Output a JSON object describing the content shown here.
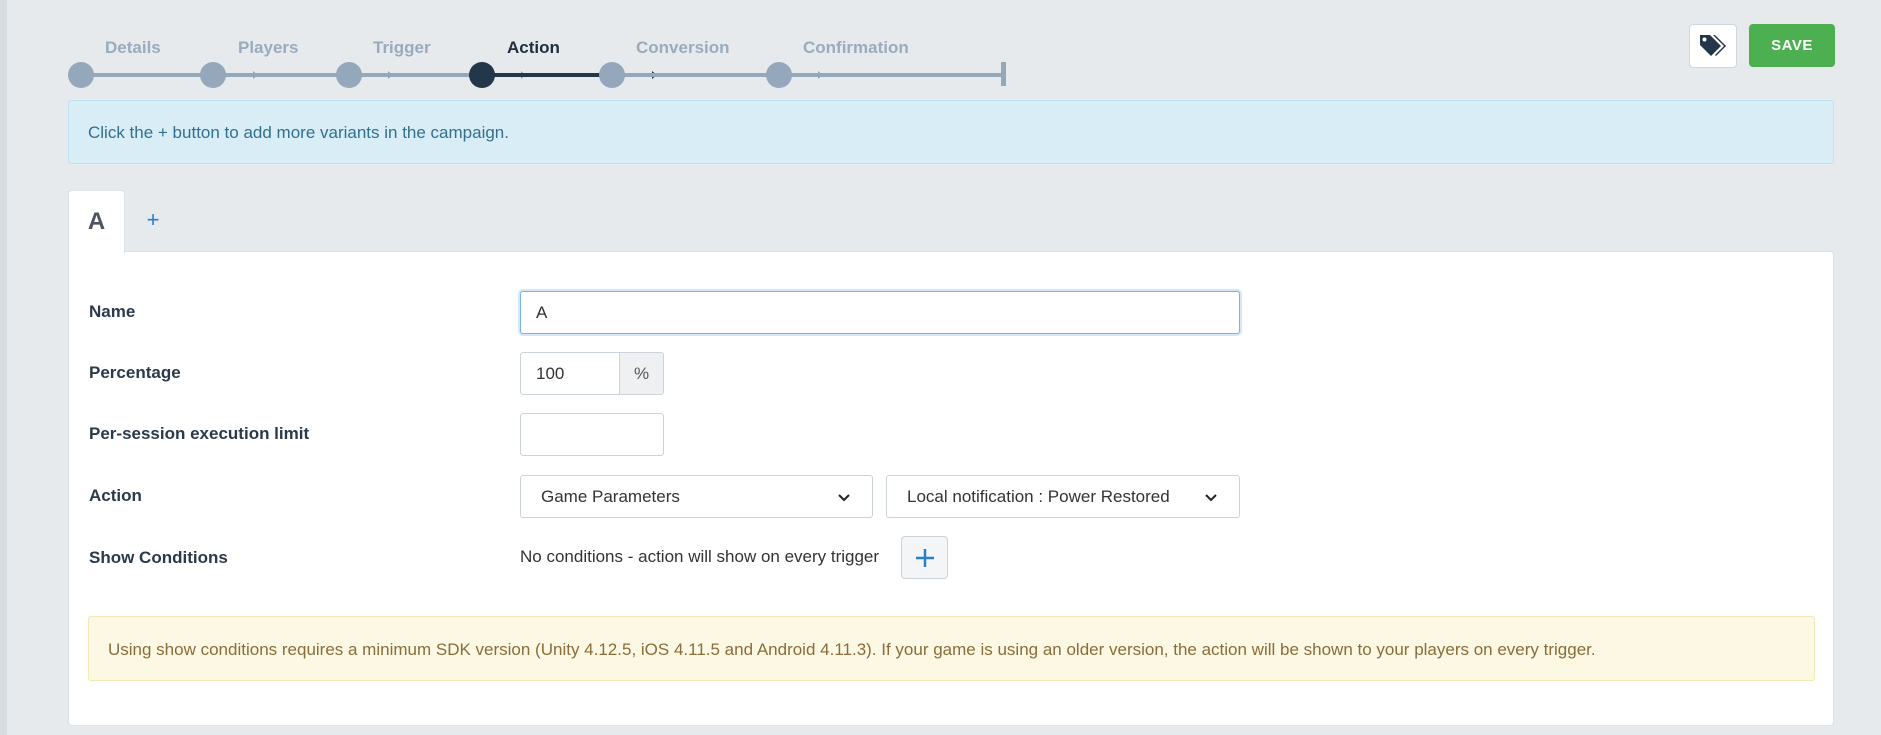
{
  "wizard": {
    "steps": [
      {
        "label": "Details",
        "state": "done"
      },
      {
        "label": "Players",
        "state": "done"
      },
      {
        "label": "Trigger",
        "state": "done"
      },
      {
        "label": "Action",
        "state": "active"
      },
      {
        "label": "Conversion",
        "state": "pending"
      },
      {
        "label": "Confirmation",
        "state": "pending"
      }
    ]
  },
  "header": {
    "tag_icon": "tags-icon",
    "save_label": "SAVE"
  },
  "info_banner": {
    "text": "Click the + button to add more variants in the campaign."
  },
  "tabs": {
    "variants": [
      "A"
    ],
    "add_label": "+"
  },
  "form": {
    "name": {
      "label": "Name",
      "value": "A"
    },
    "percentage": {
      "label": "Percentage",
      "value": "100",
      "unit": "%"
    },
    "session_limit": {
      "label": "Per-session execution limit",
      "value": ""
    },
    "action": {
      "label": "Action",
      "type_value": "Game Parameters",
      "detail_value": "Local notification : Power Restored"
    },
    "show_conditions": {
      "label": "Show Conditions",
      "empty_text": "No conditions - action will show on every trigger",
      "add_icon": "plus-icon"
    }
  },
  "warning_banner": {
    "text": "Using show conditions requires a minimum SDK version (Unity 4.12.5, iOS 4.11.5 and Android 4.11.3). If your game is using an older version, the action will be shown to your players on every trigger."
  },
  "colors": {
    "save": "#4caf50",
    "active_step": "#24364a",
    "inactive_step": "#95a8bb",
    "info_bg": "#d9edf7",
    "warning_bg": "#fcf8e3"
  }
}
